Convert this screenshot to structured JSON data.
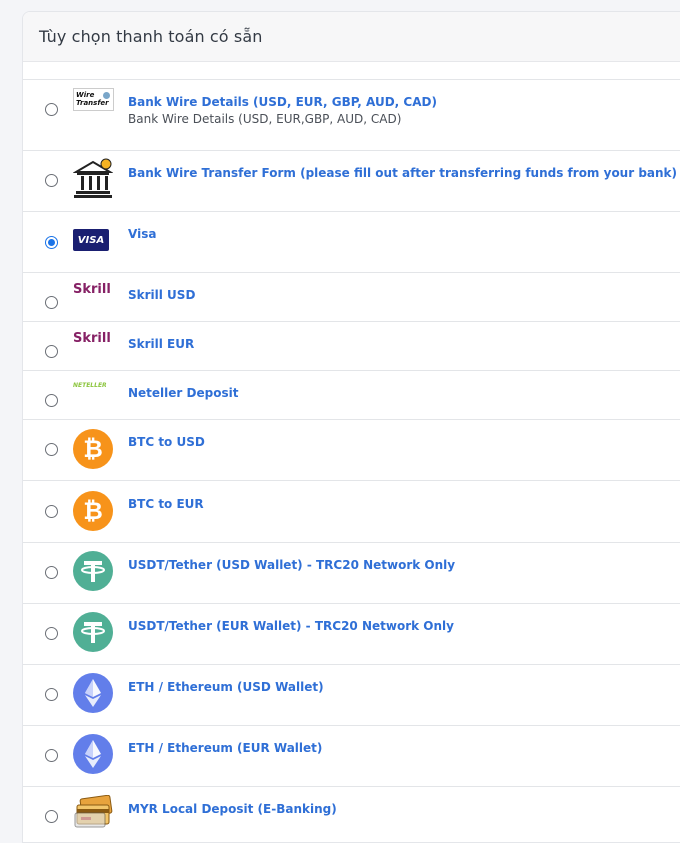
{
  "header": {
    "title": "Tùy chọn thanh toán có sẵn"
  },
  "methods": [
    {
      "label": "Bank Wire Details (USD, EUR, GBP, AUD, CAD)",
      "sub": "Bank Wire Details (USD, EUR,GBP, AUD, CAD)",
      "icon": "wire-transfer-icon",
      "icon_text": [
        "Wire",
        "Transfer"
      ],
      "checked": false
    },
    {
      "label": "Bank Wire Transfer Form (please fill out after transferring funds from your bank)",
      "icon": "bank-building-icon",
      "checked": false
    },
    {
      "label": "Visa",
      "icon": "visa-icon",
      "icon_text": "VISA",
      "checked": true
    },
    {
      "label": "Skrill USD",
      "icon": "skrill-icon",
      "icon_text": "Skrill",
      "checked": false
    },
    {
      "label": "Skrill EUR",
      "icon": "skrill-icon",
      "icon_text": "Skrill",
      "checked": false
    },
    {
      "label": "Neteller Deposit",
      "icon": "neteller-icon",
      "icon_text": "NETELLER",
      "checked": false
    },
    {
      "label": "BTC to USD",
      "icon": "bitcoin-icon",
      "checked": false
    },
    {
      "label": "BTC to EUR",
      "icon": "bitcoin-icon",
      "checked": false
    },
    {
      "label": "USDT/Tether (USD Wallet) - TRC20 Network Only",
      "icon": "tether-icon",
      "checked": false
    },
    {
      "label": "USDT/Tether (EUR Wallet) - TRC20 Network Only",
      "icon": "tether-icon",
      "checked": false
    },
    {
      "label": "ETH / Ethereum (USD Wallet)",
      "icon": "ethereum-icon",
      "checked": false
    },
    {
      "label": "ETH / Ethereum (EUR Wallet)",
      "icon": "ethereum-icon",
      "checked": false
    },
    {
      "label": "MYR Local Deposit (E-Banking)",
      "icon": "bank-cards-icon",
      "checked": false
    }
  ],
  "colors": {
    "link": "#2f6fd6",
    "bitcoin": "#f7931a",
    "tether": "#50af95",
    "ethereum": "#627eea",
    "visa": "#1a1f71",
    "skrill": "#862165",
    "neteller": "#8dc63f"
  }
}
